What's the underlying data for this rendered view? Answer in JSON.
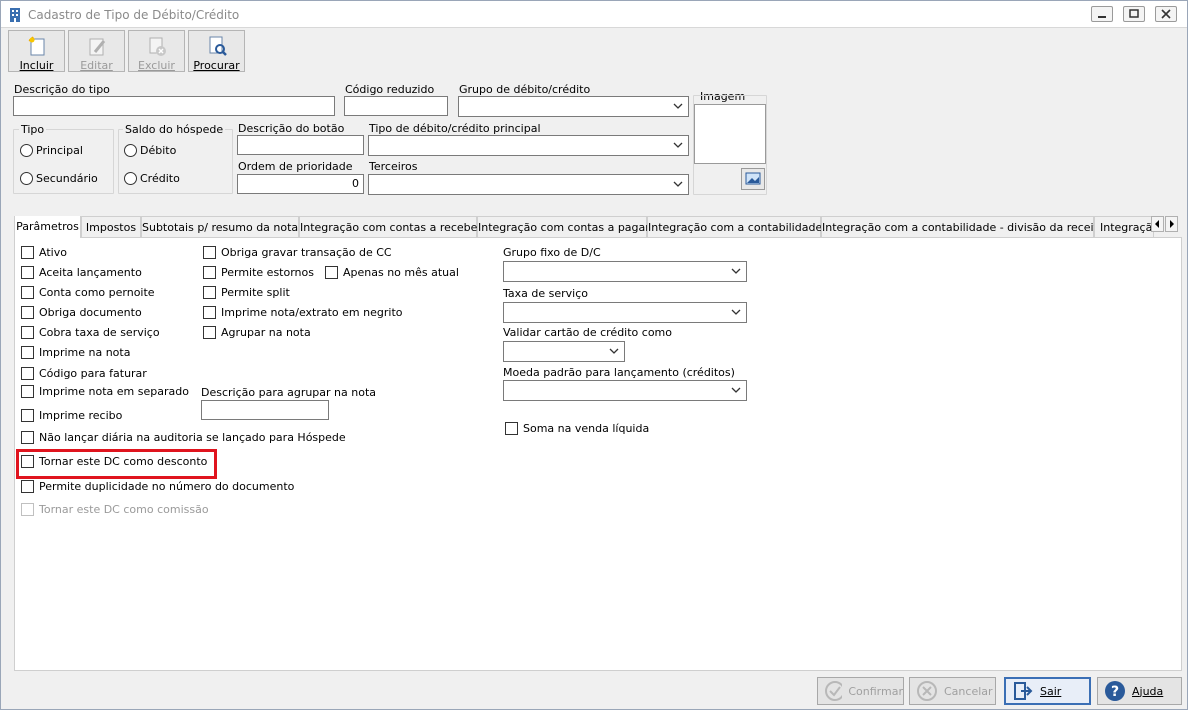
{
  "window": {
    "title": "Cadastro de Tipo de Débito/Crédito"
  },
  "toolbar": {
    "incluir": "Incluir",
    "editar": "Editar",
    "excluir": "Excluir",
    "procurar": "Procurar"
  },
  "header": {
    "descricao_tipo_label": "Descrição do tipo",
    "codigo_reduzido_label": "Código reduzido",
    "grupo_label": "Grupo de débito/crédito",
    "imagem_label": "Imagem",
    "tipo_group": "Tipo",
    "tipo_principal": "Principal",
    "tipo_secundario": "Secundário",
    "saldo_group": "Saldo do hóspede",
    "saldo_debito": "Débito",
    "saldo_credito": "Crédito",
    "descricao_botao_label": "Descrição do botão",
    "tipo_principal_label": "Tipo de débito/crédito principal",
    "ordem_prioridade_label": "Ordem de prioridade",
    "ordem_prioridade_value": "0",
    "terceiros_label": "Terceiros"
  },
  "tabs": [
    "Parâmetros",
    "Impostos",
    "Subtotais p/ resumo da nota",
    "Integração com contas a receber",
    "Integração com contas a pagar",
    "Integração com a contabilidade",
    "Integração com a contabilidade - divisão da receita",
    "Integraçã"
  ],
  "params": {
    "col1": [
      "Ativo",
      "Aceita lançamento",
      "Conta como pernoite",
      "Obriga documento",
      "Cobra taxa de serviço",
      "Imprime na nota",
      "Código para faturar",
      "Imprime nota em separado",
      "Imprime recibo",
      "Não lançar diária na auditoria se lançado para Hóspede",
      "Tornar este DC como desconto",
      "Permite duplicidade no número do documento",
      "Tornar este DC como comissão"
    ],
    "col2": [
      "Obriga gravar transação de CC",
      "Permite estornos",
      "Permite split",
      "Imprime nota/extrato em negrito",
      "Agrupar na nota"
    ],
    "apenas_mes_atual": "Apenas no mês atual",
    "descricao_agrupar_label": "Descrição para agrupar na nota",
    "grupo_fixo_label": "Grupo fixo de D/C",
    "taxa_servico_label": "Taxa de serviço",
    "validar_cartao_label": "Validar cartão de crédito como",
    "moeda_padrao_label": "Moeda padrão para lançamento (créditos)",
    "soma_venda": "Soma na venda líquida"
  },
  "footer": {
    "confirmar": "Confirmar",
    "cancelar": "Cancelar",
    "sair": "Sair",
    "ajuda": "Ajuda"
  },
  "colors": {
    "highlight": "#e0141e",
    "accent": "#3b6fb5"
  }
}
